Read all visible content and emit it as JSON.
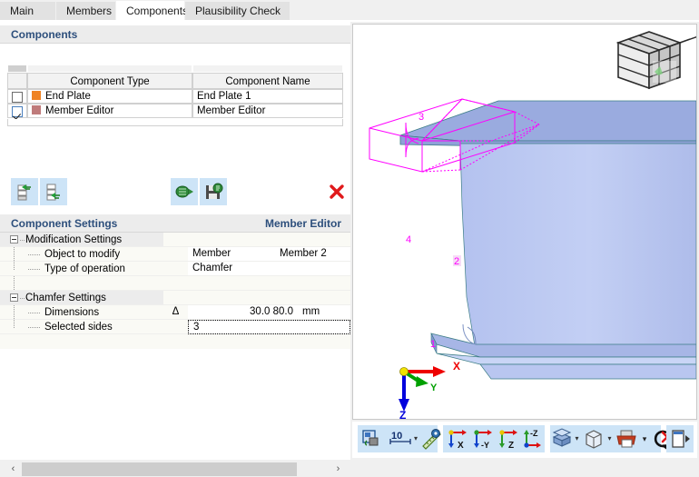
{
  "window": {
    "tabs": [
      {
        "label": "Main",
        "active": false
      },
      {
        "label": "Members",
        "active": false
      },
      {
        "label": "Components",
        "active": true
      },
      {
        "label": "Plausibility Check",
        "active": false
      }
    ]
  },
  "components_panel": {
    "header_title": "Components",
    "columns": [
      "",
      "Component Type",
      "Component Name"
    ],
    "rows": [
      {
        "checked": false,
        "color": "#ef8324",
        "type": "End Plate",
        "name": "End Plate 1"
      },
      {
        "checked": true,
        "color": "#bf7b7b",
        "type": "Member Editor",
        "name": "Member Editor"
      }
    ],
    "toolbar": [
      {
        "name": "new-component-icon",
        "title": "New Component"
      },
      {
        "name": "insert-component-icon",
        "title": "Insert Component"
      },
      {
        "name": "import-component-icon",
        "title": "Import Component"
      },
      {
        "name": "save-component-icon",
        "title": "Save Component"
      },
      {
        "name": "delete-component-icon",
        "title": "Delete Component"
      }
    ]
  },
  "component_settings": {
    "header_title": "Component Settings",
    "header_right": "Member Editor",
    "groups": [
      {
        "label": "Modification Settings",
        "rows": [
          {
            "label": "Object to modify",
            "delta": "",
            "v1": "Member",
            "v2": "Member 2"
          },
          {
            "label": "Type of operation",
            "delta": "",
            "v1": "Chamfer",
            "v2": ""
          }
        ]
      },
      {
        "label": "Chamfer Settings",
        "rows": [
          {
            "label": "Dimensions",
            "delta": "Δ",
            "value": "30.0 80.0",
            "unit": "mm"
          },
          {
            "label": "Selected sides",
            "delta": "",
            "value": "3",
            "unit": ""
          }
        ]
      }
    ]
  },
  "scrollbar": {
    "left_arrow": "‹",
    "right_arrow": "›"
  },
  "viewport": {
    "navigation_cube": "navigation-cube",
    "node_labels": [
      "3",
      "4",
      "2",
      "1"
    ],
    "axes": [
      {
        "name": "X",
        "color": "#ee0000"
      },
      {
        "name": "Y",
        "color": "#00a000"
      },
      {
        "name": "Z",
        "color": "#0000dd"
      }
    ],
    "toolbar": [
      {
        "name": "render-mode-button",
        "label": ""
      },
      {
        "name": "scale-value",
        "label": "10"
      },
      {
        "name": "scale-dropdown-arrow",
        "label": "▾"
      },
      {
        "name": "measure-button",
        "label": ""
      },
      {
        "name": "view-x-button",
        "label": "X"
      },
      {
        "name": "view-y-button",
        "label": "-Y"
      },
      {
        "name": "view-z-button",
        "label": "Z"
      },
      {
        "name": "view-iso-button",
        "label": "-Z"
      },
      {
        "name": "display-mode-button",
        "label": ""
      },
      {
        "name": "display-mode-arrow",
        "label": "▾"
      },
      {
        "name": "wireframe-button",
        "label": ""
      },
      {
        "name": "wireframe-arrow",
        "label": "▾"
      },
      {
        "name": "print-button",
        "label": ""
      },
      {
        "name": "print-arrow",
        "label": "▾"
      },
      {
        "name": "clear-selection-button",
        "label": ""
      },
      {
        "name": "panel-toggle-button",
        "label": "▸"
      }
    ]
  },
  "colors": {
    "accent": "#2d4f7c",
    "toolbar_button_bg": "#cde4f7",
    "wireframe": "#ff00ff",
    "model_face": "#aab9ea"
  }
}
